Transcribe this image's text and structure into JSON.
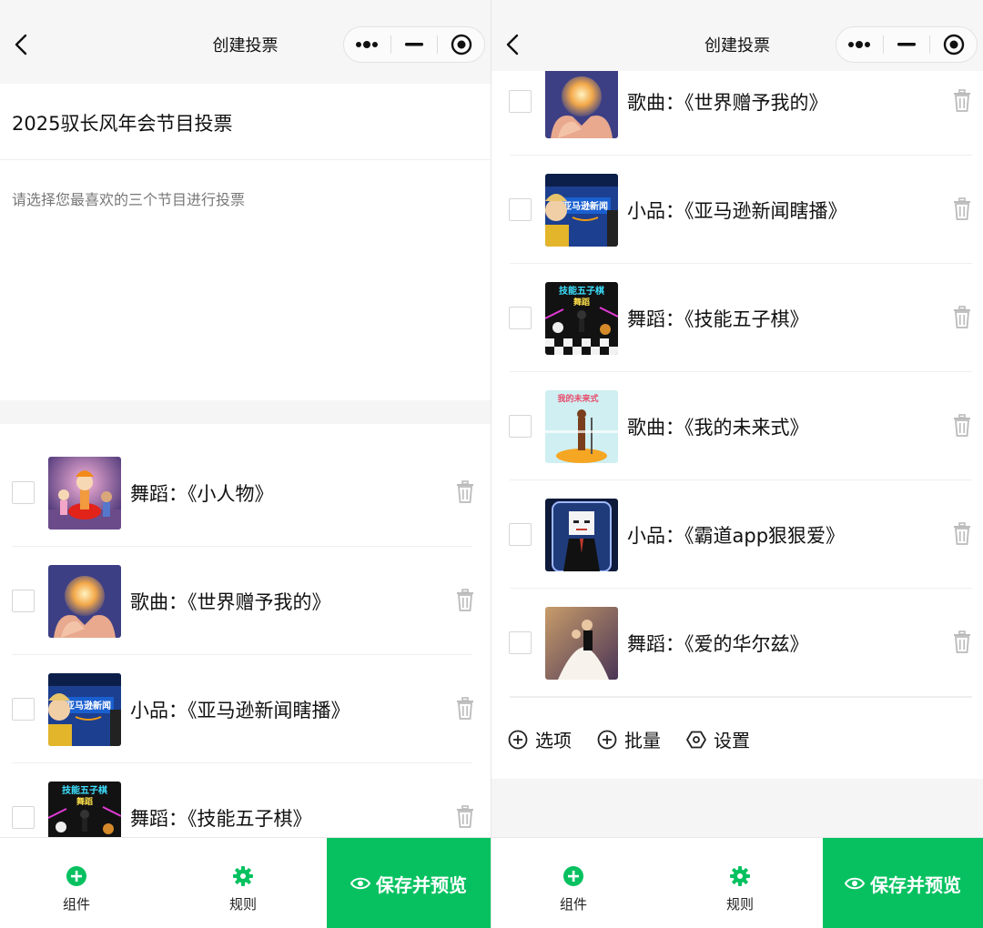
{
  "nav": {
    "title": "创建投票"
  },
  "poll": {
    "title": "2025驭长风年会节目投票",
    "description": "请选择您最喜欢的三个节目进行投票"
  },
  "left_options": [
    {
      "label": "舞蹈：《小人物》",
      "thumb": "dance-puppets"
    },
    {
      "label": "歌曲：《世界赠予我的》",
      "thumb": "globe-hands"
    },
    {
      "label": "小品：《亚马逊新闻瞎播》",
      "thumb": "amazon-news"
    },
    {
      "label": "舞蹈：《技能五子棋》",
      "thumb": "gomoku-dance"
    }
  ],
  "right_options": [
    {
      "label": "歌曲：《世界赠予我的》",
      "thumb": "globe-hands"
    },
    {
      "label": "小品：《亚马逊新闻瞎播》",
      "thumb": "amazon-news"
    },
    {
      "label": "舞蹈：《技能五子棋》",
      "thumb": "gomoku-dance"
    },
    {
      "label": "歌曲：《我的未来式》",
      "thumb": "singer-stage"
    },
    {
      "label": "小品：《霸道app狠狠爱》",
      "thumb": "app-boss"
    },
    {
      "label": "舞蹈：《爱的华尔兹》",
      "thumb": "waltz-couple"
    }
  ],
  "thumb_text": {
    "amazon": "亚马逊新闻",
    "gomoku_line1": "技能五子棋",
    "gomoku_line2": "舞蹈",
    "future": "我的未来式"
  },
  "toolbar": {
    "option": "选项",
    "batch": "批量",
    "settings": "设置"
  },
  "bottom": {
    "components": "组件",
    "rules": "规则",
    "save_preview": "保存并预览"
  },
  "colors": {
    "accent": "#07c160",
    "nav_bg": "#f6f6f6",
    "band_bg": "#f5f5f5"
  }
}
